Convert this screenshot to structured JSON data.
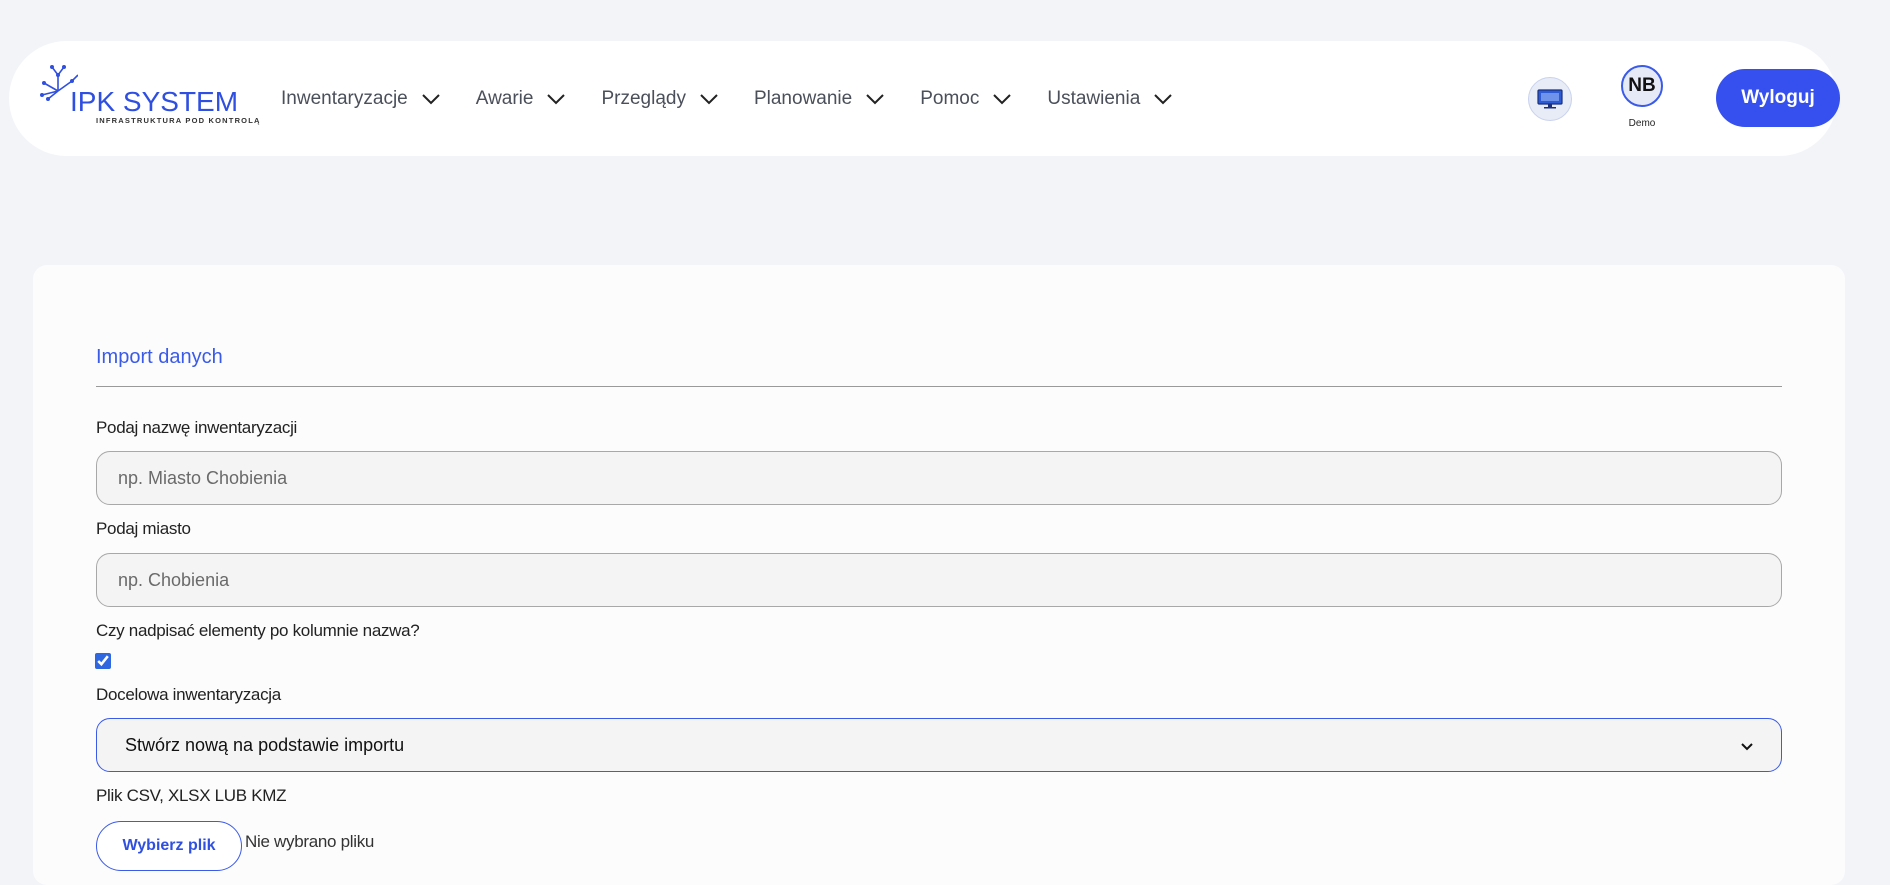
{
  "header": {
    "logo": {
      "title": "IPK SYSTEM",
      "subtitle": "INFRASTRUKTURA POD KONTROLĄ"
    },
    "nav": [
      {
        "label": "Inwentaryzacje",
        "icon": "chevron-down-icon"
      },
      {
        "label": "Awarie",
        "icon": "chevron-down-icon"
      },
      {
        "label": "Przeglądy",
        "icon": "chevron-down-icon"
      },
      {
        "label": "Planowanie",
        "icon": "chevron-down-icon"
      },
      {
        "label": "Pomoc",
        "icon": "chevron-down-icon"
      },
      {
        "label": "Ustawienia",
        "icon": "chevron-down-icon"
      }
    ],
    "screen_icon": "monitor-icon",
    "user": {
      "initials": "NB",
      "name": "Demo"
    },
    "logout_label": "Wyloguj"
  },
  "form": {
    "title": "Import danych",
    "name_label": "Podaj nazwę inwentaryzacji",
    "name_placeholder": "np. Miasto Chobienia",
    "city_label": "Podaj miasto",
    "city_placeholder": "np. Chobienia",
    "overwrite_label": "Czy nadpisać elementy po kolumnie nazwa?",
    "overwrite_checked": true,
    "target_label": "Docelowa inwentaryzacja",
    "target_selected": "Stwórz nową na podstawie importu",
    "file_label": "Plik CSV, XLSX LUB KMZ",
    "file_button": "Wybierz plik",
    "file_status": "Nie wybrano pliku"
  },
  "colors": {
    "accent": "#3550ef",
    "background": "#f3f4f8",
    "card": "#fcfcfc"
  }
}
